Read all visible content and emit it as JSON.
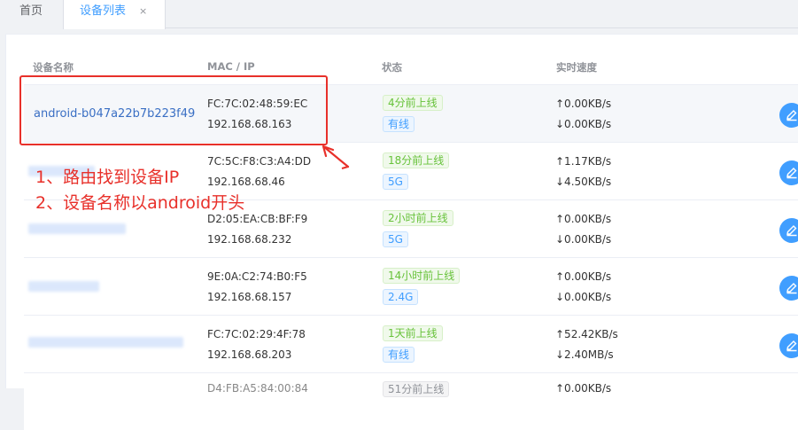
{
  "tabs": {
    "home": "首页",
    "devices": "设备列表",
    "close": "×"
  },
  "table": {
    "headers": {
      "name": "设备名称",
      "mac_ip": "MAC / IP",
      "status": "状态",
      "speed": "实时速度"
    },
    "rows": [
      {
        "name": "android-b047a22b7b223f49",
        "mac": "FC:7C:02:48:59:EC",
        "ip": "192.168.68.163",
        "online": "4分前上线",
        "net": "有线",
        "up": "↑0.00KB/s",
        "down": "↓0.00KB/s"
      },
      {
        "name": "",
        "mac": "7C:5C:F8:C3:A4:DD",
        "ip": "192.168.68.46",
        "online": "18分前上线",
        "net": "5G",
        "up": "↑1.17KB/s",
        "down": "↓4.50KB/s"
      },
      {
        "name": "",
        "mac": "D2:05:EA:CB:BF:F9",
        "ip": "192.168.68.232",
        "online": "2小时前上线",
        "net": "5G",
        "up": "↑0.00KB/s",
        "down": "↓0.00KB/s"
      },
      {
        "name": "",
        "mac": "9E:0A:C2:74:B0:F5",
        "ip": "192.168.68.157",
        "online": "14小时前上线",
        "net": "2.4G",
        "up": "↑0.00KB/s",
        "down": "↓0.00KB/s"
      },
      {
        "name": "",
        "mac": "FC:7C:02:29:4F:78",
        "ip": "192.168.68.203",
        "online": "1天前上线",
        "net": "有线",
        "up": "↑52.42KB/s",
        "down": "↓2.40MB/s"
      },
      {
        "name": "",
        "mac": "D4:FB:A5:84:00:84",
        "ip": "",
        "online": "51分前上线",
        "net": "",
        "up": "↑0.00KB/s",
        "down": ""
      }
    ]
  },
  "annotation": {
    "line1": "1、路由找到设备IP",
    "line2": "2、设备名称以android开头",
    "color": "#e8302a"
  },
  "colors": {
    "accent": "#409eff",
    "link": "#3a6fc4",
    "online_green": "#67c23a"
  },
  "icons": {
    "edit": "edit-icon"
  }
}
